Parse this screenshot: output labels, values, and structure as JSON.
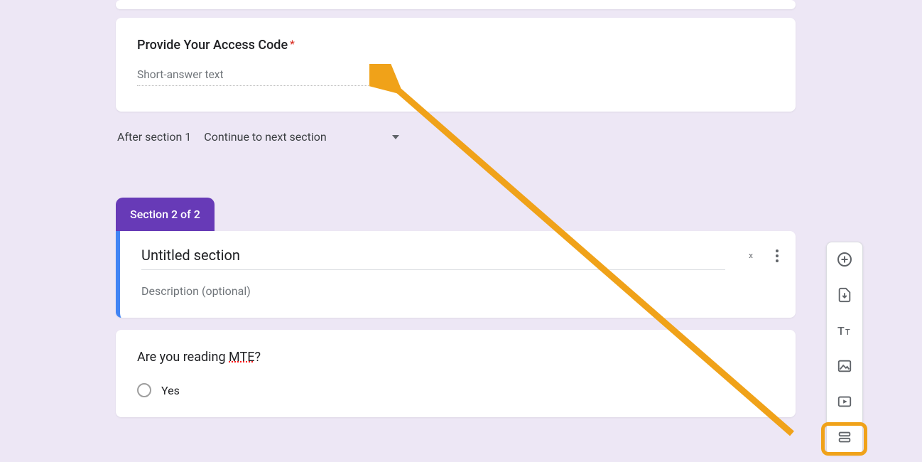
{
  "question1": {
    "title": "Provide Your Access Code",
    "required_marker": "*",
    "placeholder": "Short-answer text"
  },
  "after_section": {
    "label": "After section 1",
    "dropdown": "Continue to next section"
  },
  "section_badge": "Section 2 of 2",
  "section_header": {
    "title": "Untitled section",
    "desc_placeholder": "Description (optional)"
  },
  "question2": {
    "title_pre": "Are you reading ",
    "title_mte": "MTE",
    "title_post": "?",
    "option1": "Yes"
  },
  "toolbar": {
    "add_question": "add-question",
    "import": "import-questions",
    "title_desc": "add-title",
    "image": "add-image",
    "video": "add-video",
    "section": "add-section"
  }
}
